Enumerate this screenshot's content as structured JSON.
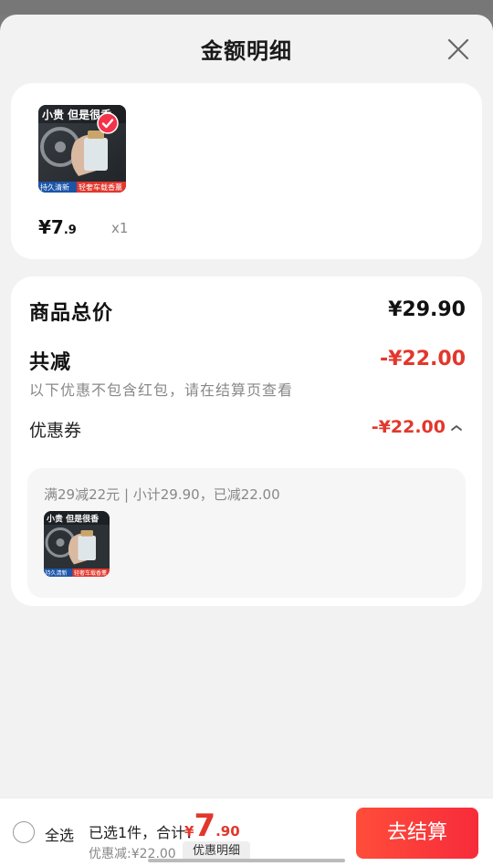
{
  "sheet": {
    "title": "金额明细"
  },
  "product": {
    "thumb_caption_top": "小贵 但是很香",
    "thumb_caption_left": "持久清新",
    "thumb_caption_right": "轻奢车载香薰",
    "price_int": "¥7",
    "price_dec": ".9",
    "qty": "x1",
    "selected": true
  },
  "breakdown": {
    "total_label": "商品总价",
    "total_value": "¥29.90",
    "reduce_label": "共减",
    "reduce_value": "-¥22.00",
    "note": "以下优惠不包含红包，请在结算页查看",
    "coupon_label": "优惠券",
    "coupon_value": "-¥22.00",
    "coupon_desc": "满29减22元 | 小计29.90，已减22.00"
  },
  "bottom_bar": {
    "select_all": "全选",
    "summary_prefix": "已选1件，合计：",
    "total_yen": "¥",
    "total_int": "7",
    "total_dec": ".90",
    "discount": "优惠减:¥22.00",
    "detail_button": "优惠明细",
    "checkout_button": "去结算"
  },
  "colors": {
    "accent": "#e2372d",
    "checkout": "#f72b3b"
  }
}
